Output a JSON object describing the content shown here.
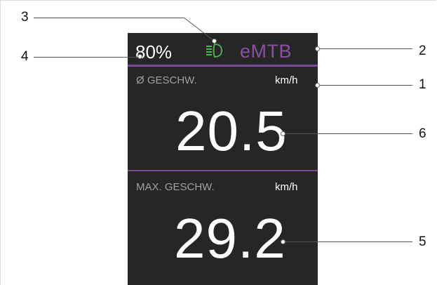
{
  "display": {
    "battery": "80%",
    "mode": "eMTB",
    "light_icon": "headlight-icon",
    "colors": {
      "background": "#262626",
      "accent": "#7a4a9a",
      "mode_text": "#8b4fa6",
      "light_icon": "#4caf50"
    },
    "avg_speed": {
      "label": "Ø GESCHW.",
      "unit": "km/h",
      "value": "20.5"
    },
    "max_speed": {
      "label": "MAX. GESCHW.",
      "unit": "km/h",
      "value": "29.2"
    }
  },
  "callouts": [
    "1",
    "2",
    "3",
    "4",
    "5",
    "6"
  ]
}
